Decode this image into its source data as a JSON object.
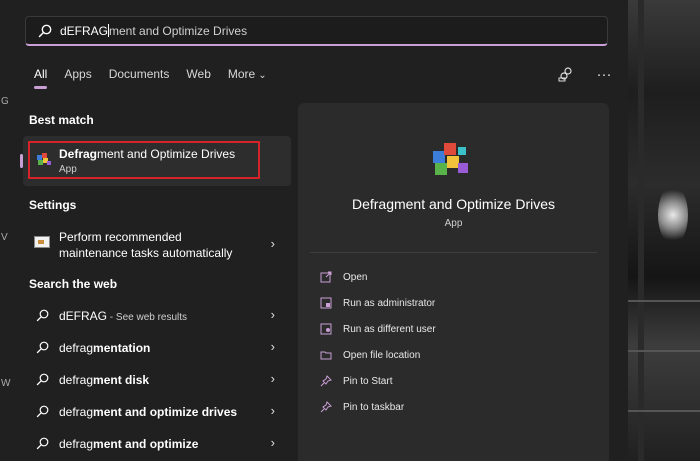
{
  "search": {
    "typed": "dEFRAG",
    "suggestion": "ment and Optimize Drives"
  },
  "tabs": [
    {
      "label": "All",
      "active": true
    },
    {
      "label": "Apps"
    },
    {
      "label": "Documents"
    },
    {
      "label": "Web"
    },
    {
      "label": "More"
    }
  ],
  "toolbar": {
    "share_icon": "people-connect-icon",
    "more_label": "···"
  },
  "best_match": {
    "heading": "Best match",
    "name_bold": "Defrag",
    "name_rest": "ment and Optimize Drives",
    "type": "App"
  },
  "settings": {
    "heading": "Settings",
    "item_line1": "Perform recommended",
    "item_line2": "maintenance tasks automatically"
  },
  "web": {
    "heading": "Search the web",
    "items": [
      {
        "normal": "dEFRAG",
        "bold": "",
        "suffix": " - See web results"
      },
      {
        "normal": "defrag",
        "bold": "mentation",
        "suffix": ""
      },
      {
        "normal": "defrag",
        "bold": "ment disk",
        "suffix": ""
      },
      {
        "normal": "defrag",
        "bold": "ment and optimize drives",
        "suffix": ""
      },
      {
        "normal": "defrag",
        "bold": "ment and optimize",
        "suffix": ""
      }
    ]
  },
  "preview": {
    "title": "Defragment and Optimize Drives",
    "type": "App",
    "actions": [
      {
        "label": "Open",
        "icon": "open-icon"
      },
      {
        "label": "Run as administrator",
        "icon": "shield-icon"
      },
      {
        "label": "Run as different user",
        "icon": "user-icon"
      },
      {
        "label": "Open file location",
        "icon": "folder-icon"
      },
      {
        "label": "Pin to Start",
        "icon": "pin-icon"
      },
      {
        "label": "Pin to taskbar",
        "icon": "pin-icon"
      }
    ]
  },
  "desktop_edge": {
    "letters": [
      "G",
      "V",
      "W"
    ]
  },
  "colors": {
    "accent": "#c99fd6",
    "highlight_box": "#d4232a",
    "panel": "#202020",
    "preview": "#2b2b2b"
  }
}
